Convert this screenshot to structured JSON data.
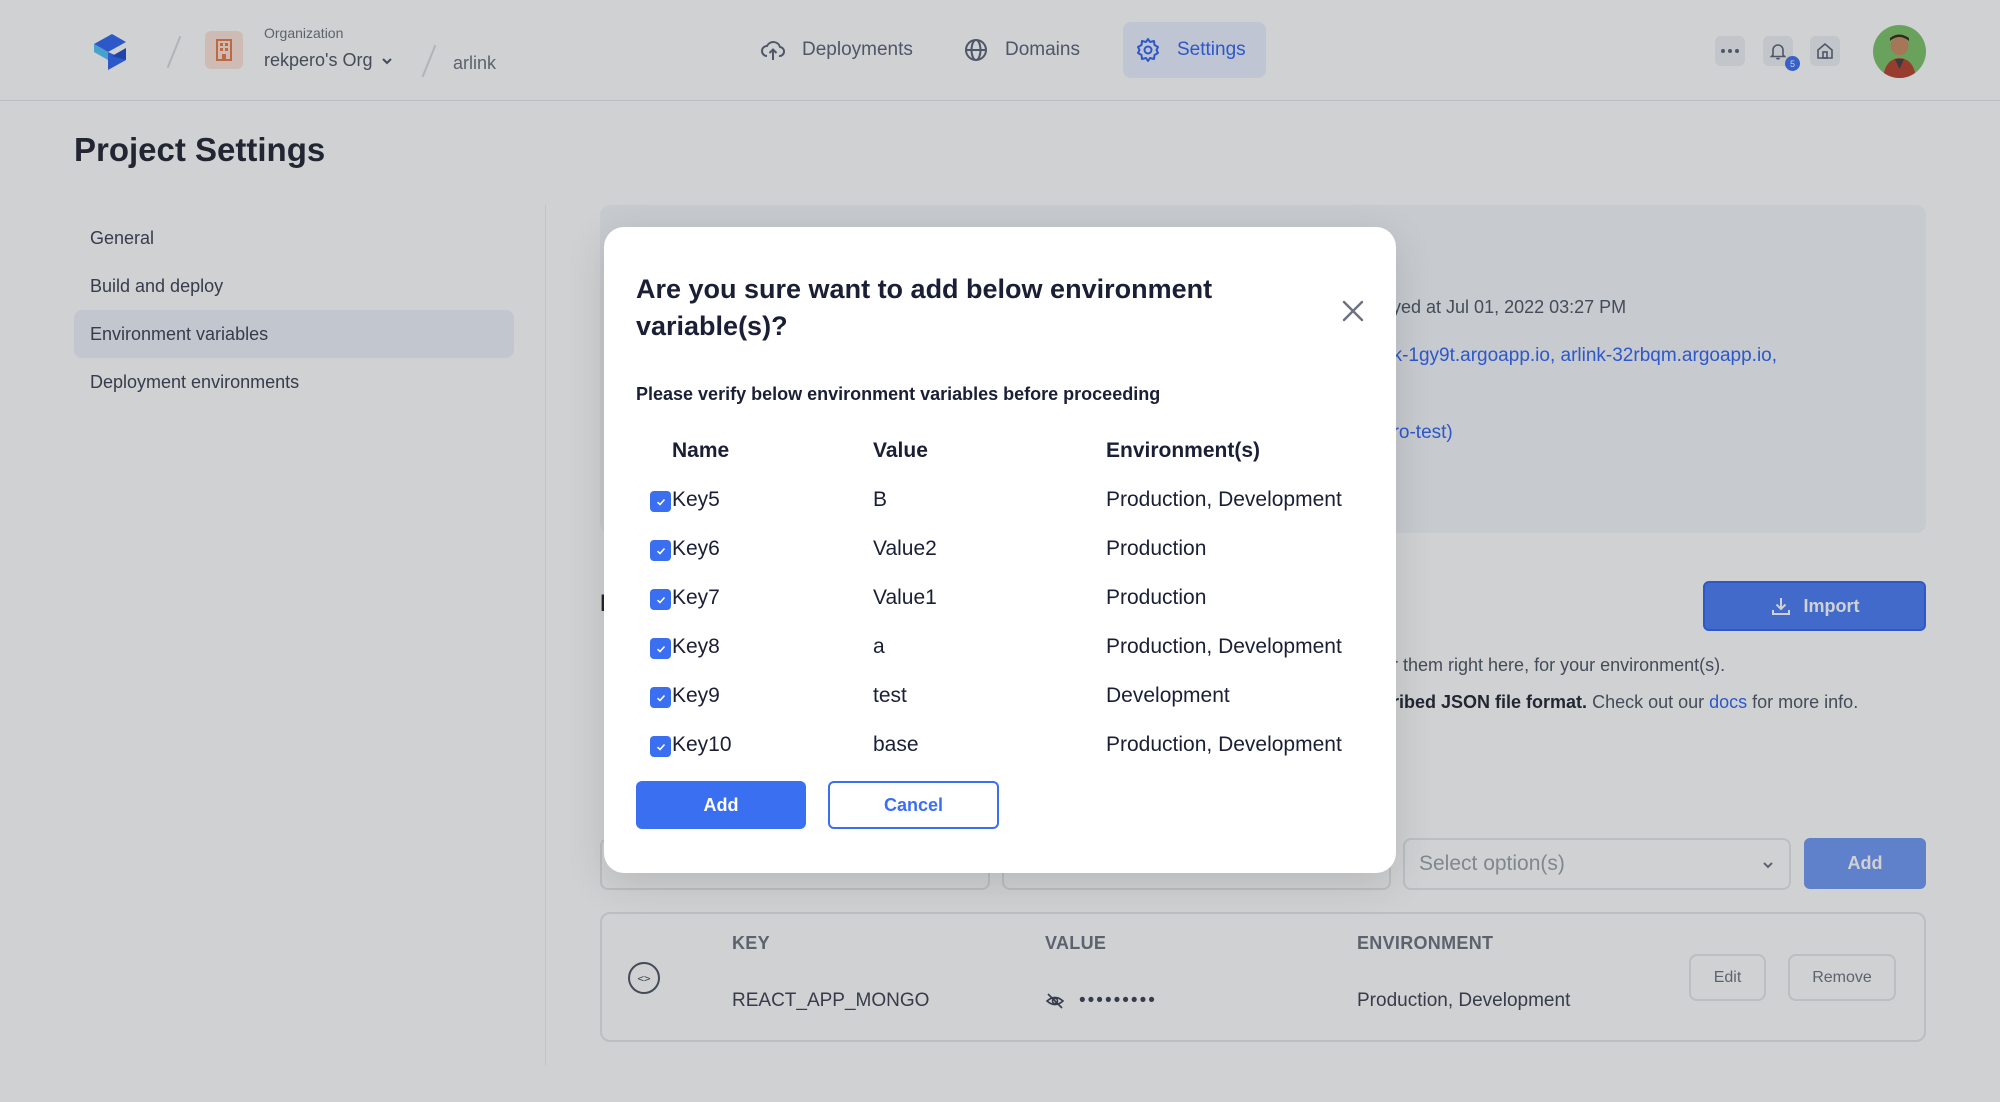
{
  "topbar": {
    "org_label": "Organization",
    "org_name": "rekpero's Org",
    "project_name": "arlink",
    "nav": [
      {
        "label": "Deployments",
        "icon": "upload-cloud-icon"
      },
      {
        "label": "Domains",
        "icon": "globe-icon"
      },
      {
        "label": "Settings",
        "icon": "gear-icon"
      }
    ],
    "notification_count": "5"
  },
  "page": {
    "title": "Project Settings",
    "sidebar": [
      {
        "label": "General"
      },
      {
        "label": "Build and deploy"
      },
      {
        "label": "Environment variables",
        "active": true
      },
      {
        "label": "Deployment environments"
      }
    ]
  },
  "background": {
    "deployed_text": "oyed at Jul 01, 2022 03:27 PM",
    "domains_text": "nk-1gy9t.argoapp.io, arlink-32rbqm.argoapp.io,",
    "branch_text": "ero-test)",
    "section_title_frag": "I",
    "import_label": "Import",
    "desc_line1": "er them right here, for your environment(s).",
    "desc_line2_bold": "cribed JSON file format.",
    "desc_line2_mid": " Check out our ",
    "desc_line2_link": "docs",
    "desc_line2_end": " for more info.",
    "select_placeholder": "Select option(s)",
    "add_label": "Add",
    "table": {
      "headers": {
        "key": "KEY",
        "value": "VALUE",
        "environment": "ENVIRONMENT"
      },
      "row": {
        "key": "REACT_APP_MONGO",
        "value_masked": "•••••••••",
        "environment": "Production, Development"
      },
      "code_glyph": "<>",
      "edit_label": "Edit",
      "remove_label": "Remove"
    }
  },
  "modal": {
    "title": "Are you sure want to add below environment variable(s)?",
    "subtitle": "Please verify below environment variables before proceeding",
    "columns": {
      "name": "Name",
      "value": "Value",
      "envs": "Environment(s)"
    },
    "rows": [
      {
        "name": "Key5",
        "value": "B",
        "envs": "Production, Development",
        "checked": true
      },
      {
        "name": "Key6",
        "value": "Value2",
        "envs": "Production",
        "checked": true
      },
      {
        "name": "Key7",
        "value": "Value1",
        "envs": "Production",
        "checked": true
      },
      {
        "name": "Key8",
        "value": "a",
        "envs": "Production, Development",
        "checked": true
      },
      {
        "name": "Key9",
        "value": "test",
        "envs": "Development",
        "checked": true
      },
      {
        "name": "Key10",
        "value": "base",
        "envs": "Production, Development",
        "checked": true
      }
    ],
    "add_label": "Add",
    "cancel_label": "Cancel"
  },
  "colors": {
    "accent": "#3b6ff2",
    "overlay": "#282c34"
  }
}
